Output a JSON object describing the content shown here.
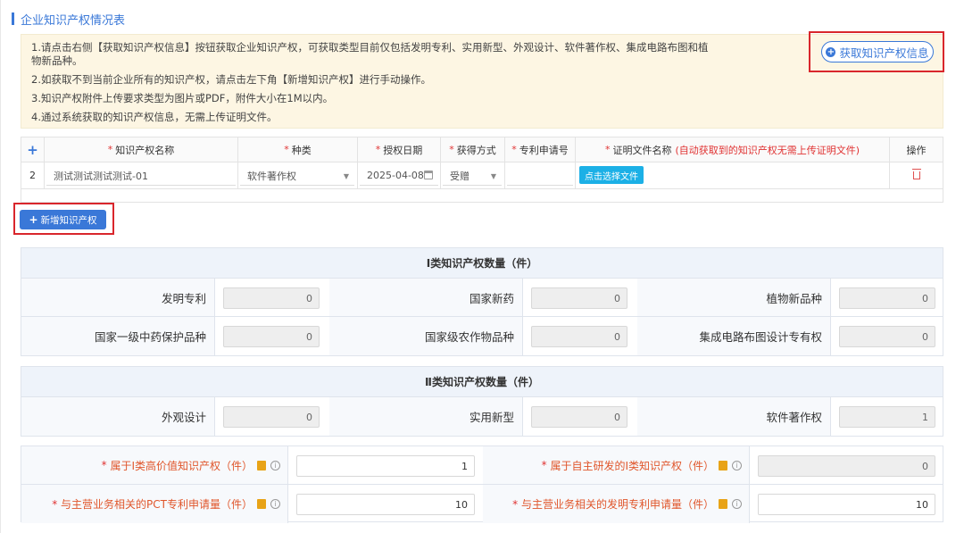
{
  "section": {
    "title": "企业知识产权情况表"
  },
  "notice": {
    "lines": [
      "1.请点击右侧【获取知识产权信息】按钮获取企业知识产权，可获取类型目前仅包括发明专利、实用新型、外观设计、软件著作权、集成电路布图和植",
      "物新品种。",
      "2.如获取不到当前企业所有的知识产权，请点击左下角【新增知识产权】进行手动操作。",
      "3.知识产权附件上传要求类型为图片或PDF，附件大小在1M以内。",
      "4.通过系统获取的知识产权信息，无需上传证明文件。"
    ]
  },
  "fetch_button": {
    "label": "获取知识产权信息"
  },
  "table": {
    "add_symbol": "+",
    "headers": {
      "name": "知识产权名称",
      "type": "种类",
      "date": "授权日期",
      "method": "获得方式",
      "patent_no": "专利申请号",
      "cert": "证明文件名称",
      "cert_note": "(自动获取到的知识产权无需上传证明文件)",
      "action": "操作"
    },
    "row": {
      "index": "2",
      "name": "测试测试测试测试-01",
      "type": "软件著作权",
      "date": "2025-04-08",
      "method": "受赠",
      "patent_no": "",
      "upload_label": "点击选择文件"
    }
  },
  "add_button": {
    "label": "新增知识产权"
  },
  "class1": {
    "title": "Ⅰ类知识产权数量（件）",
    "rows": [
      [
        {
          "label": "发明专利",
          "value": "0"
        },
        {
          "label": "国家新药",
          "value": "0"
        },
        {
          "label": "植物新品种",
          "value": "0"
        }
      ],
      [
        {
          "label": "国家一级中药保护品种",
          "value": "0"
        },
        {
          "label": "国家级农作物品种",
          "value": "0"
        },
        {
          "label": "集成电路布图设计专有权",
          "value": "0"
        }
      ]
    ]
  },
  "class2": {
    "title": "Ⅱ类知识产权数量（件）",
    "rows": [
      [
        {
          "label": "外观设计",
          "value": "0"
        },
        {
          "label": "实用新型",
          "value": "0"
        },
        {
          "label": "软件著作权",
          "value": "1"
        }
      ]
    ]
  },
  "bottom": {
    "required_mark": "*",
    "info_glyph": "i",
    "rows": [
      [
        {
          "label": "属于Ⅰ类高价值知识产权（件）",
          "value": "1",
          "disabled": false
        },
        {
          "label": "属于自主研发的Ⅰ类知识产权（件）",
          "value": "0",
          "disabled": true
        }
      ],
      [
        {
          "label": "与主营业务相关的PCT专利申请量（件）",
          "value": "10",
          "disabled": false
        },
        {
          "label": "与主营业务相关的发明专利申请量（件）",
          "value": "10",
          "disabled": false
        }
      ]
    ]
  },
  "colors": {
    "accent": "#3a78d8",
    "highlight_border": "#d9262c",
    "required": "#e03333",
    "upload_button": "#1cb0e6",
    "notice_bg": "#fdf6e3"
  },
  "icons": {
    "fetch": "plus-circle-icon",
    "add": "plus-icon",
    "calendar": "calendar-icon",
    "delete": "trash-icon",
    "select": "chevron-down-icon",
    "hint": "book-icon",
    "info": "info-icon"
  }
}
